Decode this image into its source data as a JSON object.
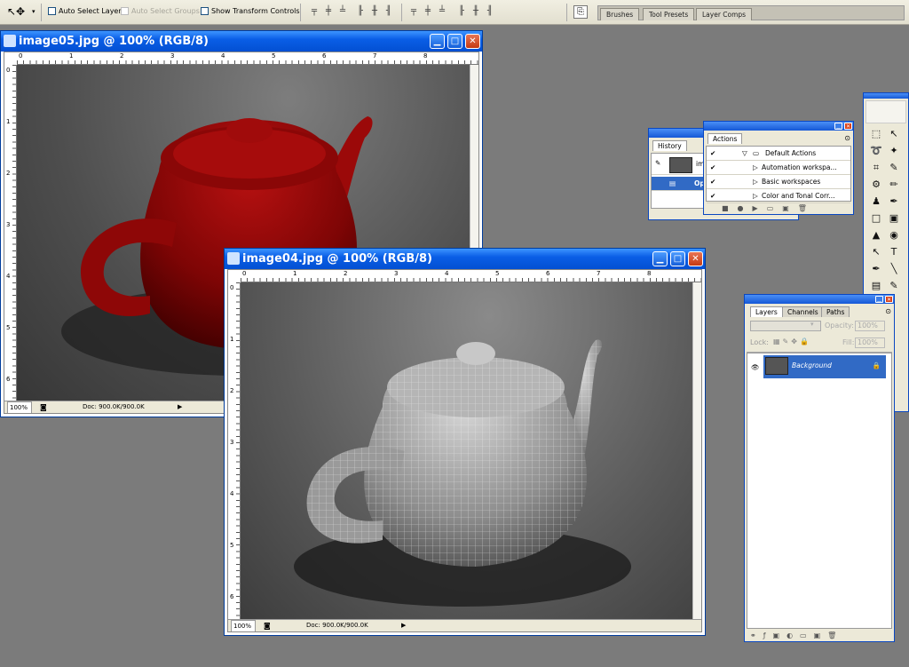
{
  "options_bar": {
    "tool_glyph": "↖✥",
    "auto_select_layer": "Auto Select Layer",
    "auto_select_groups": "Auto Select Groups",
    "show_transform_controls": "Show Transform Controls"
  },
  "palette_well": {
    "tabs": [
      "Brushes",
      "Tool Presets",
      "Layer Comps"
    ]
  },
  "windows": {
    "image05": {
      "title": "image05.jpg @ 100% (RGB/8)",
      "zoom": "100%",
      "doc": "Doc: 900.0K/900.0K",
      "h_ruler": [
        "0",
        "1",
        "2",
        "3",
        "4",
        "5",
        "6",
        "7",
        "8"
      ],
      "v_ruler": [
        "0",
        "1",
        "2",
        "3",
        "4",
        "5",
        "6"
      ]
    },
    "image04": {
      "title": "image04.jpg @ 100% (RGB/8)",
      "zoom": "100%",
      "doc": "Doc: 900.0K/900.0K",
      "h_ruler": [
        "0",
        "1",
        "2",
        "3",
        "4",
        "5",
        "6",
        "7",
        "8"
      ],
      "v_ruler": [
        "0",
        "1",
        "2",
        "3",
        "4",
        "5",
        "6"
      ]
    }
  },
  "history": {
    "tab": "History",
    "snapshot_label": "ima",
    "state_label": "Ope"
  },
  "actions": {
    "tab": "Actions",
    "items": [
      "Default Actions",
      "Automation workspa...",
      "Basic workspaces",
      "Color and Tonal Corr..."
    ]
  },
  "layers": {
    "tabs": [
      "Layers",
      "Channels",
      "Paths"
    ],
    "opacity_label": "Opacity:",
    "opacity_value": "100%",
    "lock_label": "Lock:",
    "fill_label": "Fill:",
    "fill_value": "100%",
    "layer_name": "Background"
  },
  "toolbox": {
    "tools": [
      "⬚",
      "↖",
      "➰",
      "✦",
      "⌗",
      "✎",
      "⚙",
      "✏",
      "♟",
      "✒",
      "□",
      "▣",
      "▲",
      "◉",
      "↖",
      "T",
      "✒",
      "╲",
      "▤",
      "✎"
    ]
  }
}
